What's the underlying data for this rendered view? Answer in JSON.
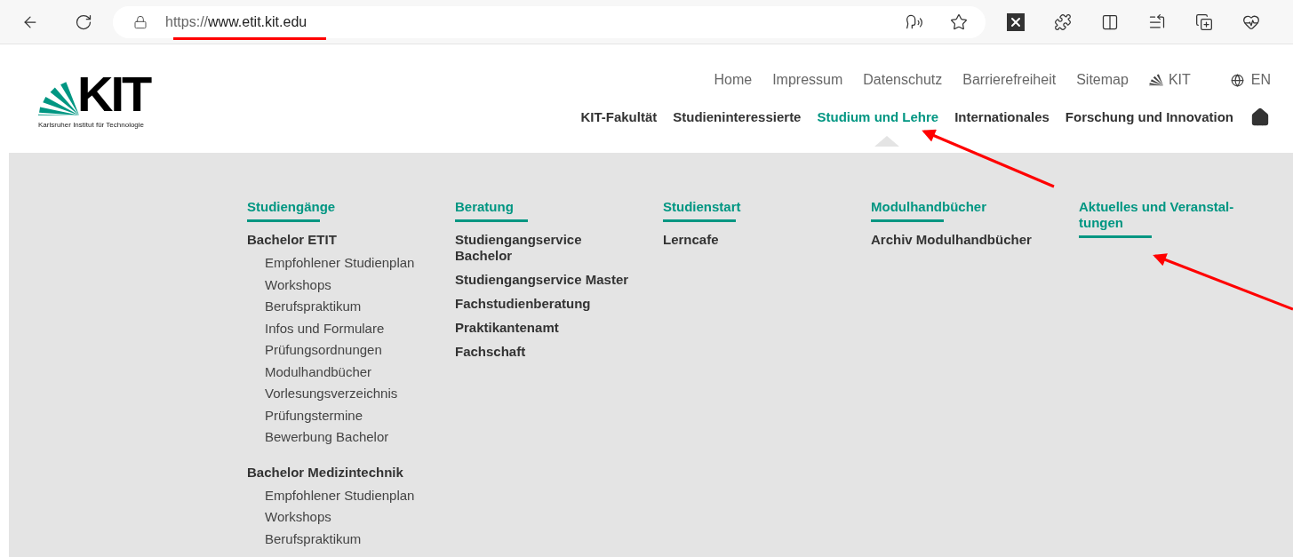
{
  "browser": {
    "url": {
      "scheme": "https://",
      "host": "www.etit.kit.edu"
    }
  },
  "logo": {
    "letters": "KIT",
    "subtitle": "Karlsruher Institut für Technologie"
  },
  "service_links": [
    {
      "label": "Home",
      "kind": "text"
    },
    {
      "label": "Impressum",
      "kind": "text"
    },
    {
      "label": "Datenschutz",
      "kind": "text"
    },
    {
      "label": "Barrierefreiheit",
      "kind": "text"
    },
    {
      "label": "Sitemap",
      "kind": "text"
    },
    {
      "label": "KIT",
      "kind": "kit"
    },
    {
      "label": "EN",
      "kind": "language"
    }
  ],
  "main_nav": [
    {
      "label": "KIT-Fakultät",
      "selected": false
    },
    {
      "label": "Studieninteressierte",
      "selected": false
    },
    {
      "label": "Studium und Lehre",
      "selected": true
    },
    {
      "label": "Internationales",
      "selected": false
    },
    {
      "label": "Forschung und Innovation",
      "selected": false
    }
  ],
  "mega_menu": [
    {
      "heading": "Studiengänge",
      "items": [
        {
          "label": "Bachelor ETIT",
          "children": [
            {
              "label": "Empfohlener Studienplan"
            },
            {
              "label": "Workshops"
            },
            {
              "label": "Berufspraktikum"
            },
            {
              "label": "Infos und Formulare"
            },
            {
              "label": "Prüfungsordnungen"
            },
            {
              "label": "Modulhandbücher"
            },
            {
              "label": "Vorlesungsverzeichnis"
            },
            {
              "label": "Prüfungstermine"
            },
            {
              "label": "Bewerbung Bachelor"
            }
          ]
        },
        {
          "label": "Bachelor Medizintechnik",
          "children": [
            {
              "label": "Empfohlener Studienplan"
            },
            {
              "label": "Workshops"
            },
            {
              "label": "Berufspraktikum"
            }
          ]
        }
      ]
    },
    {
      "heading": "Beratung",
      "items": [
        {
          "label": "Studiengangservice Bachelor"
        },
        {
          "label": "Studiengangservice Master"
        },
        {
          "label": "Fachstudienberatung"
        },
        {
          "label": "Praktikantenamt"
        },
        {
          "label": "Fachschaft"
        }
      ]
    },
    {
      "heading": "Studienstart",
      "items": [
        {
          "label": "Lerncafe"
        }
      ]
    },
    {
      "heading": "Modulhandbücher",
      "items": [
        {
          "label": "Archiv Modulhandbücher"
        }
      ]
    },
    {
      "heading": "Aktuelles und Veranstal-tungen"
    }
  ]
}
